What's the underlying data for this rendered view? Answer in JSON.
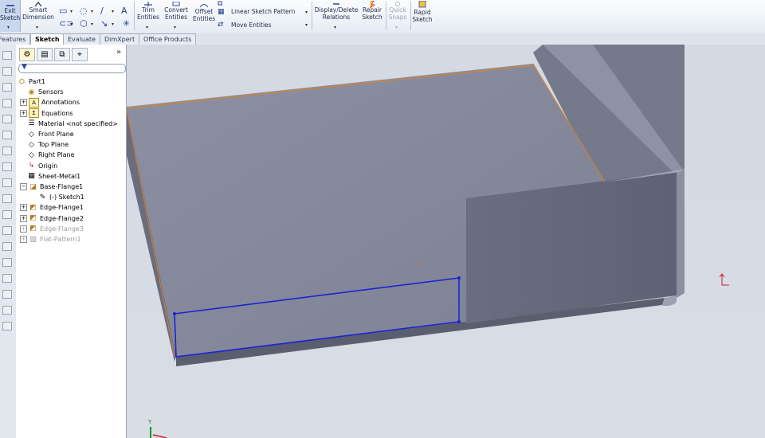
{
  "ribbon": {
    "exit_sketch": "Exit\nSketch",
    "smart_dimension": "Smart\nDimension",
    "trim_entities": "Trim\nEntities",
    "convert_entities": "Convert\nEntities",
    "offset_entities": "Offset\nEntities",
    "linear_sketch_pattern": "Linear Sketch Pattern",
    "move_entities": "Move Entities",
    "display_delete_relations": "Display/Delete\nRelations",
    "repair_sketch": "Repair\nSketch",
    "quick_snaps": "Quick\nSnaps",
    "rapid_sketch": "Rapid\nSketch"
  },
  "tabs": [
    "Features",
    "Sketch",
    "Evaluate",
    "DimXpert",
    "Office Products"
  ],
  "active_tab": "Sketch",
  "tree": {
    "nodes": [
      {
        "label": "Part1",
        "icon": "part-icon",
        "expander": ""
      },
      {
        "label": "Sensors",
        "icon": "sensors-icon",
        "expander": ""
      },
      {
        "label": "Annotations",
        "icon": "annotations-icon",
        "expander": "+"
      },
      {
        "label": "Equations",
        "icon": "equations-icon",
        "expander": "+"
      },
      {
        "label": "Material <not specified>",
        "icon": "material-icon",
        "expander": ""
      },
      {
        "label": "Front Plane",
        "icon": "plane-icon",
        "expander": ""
      },
      {
        "label": "Top Plane",
        "icon": "plane-icon",
        "expander": ""
      },
      {
        "label": "Right Plane",
        "icon": "plane-icon",
        "expander": ""
      },
      {
        "label": "Origin",
        "icon": "origin-icon",
        "expander": ""
      },
      {
        "label": "Sheet-Metal1",
        "icon": "sheet-metal-icon",
        "expander": ""
      },
      {
        "label": "Base-Flange1",
        "icon": "base-flange-icon",
        "expander": "-"
      },
      {
        "label": "(-) Sketch1",
        "icon": "sketch-icon",
        "expander": ""
      },
      {
        "label": "Edge-Flange1",
        "icon": "edge-flange-icon",
        "expander": "+"
      },
      {
        "label": "Edge-Flange2",
        "icon": "edge-flange-icon",
        "expander": "+"
      },
      {
        "label": "Edge-Flange3",
        "icon": "edge-flange-icon",
        "expander": "+"
      },
      {
        "label": "Flat-Pattern1",
        "icon": "flat-pattern-icon",
        "expander": "+"
      }
    ]
  },
  "viewport": {
    "triad_y_label": "Y",
    "sketch_color": "#1a23d6",
    "edge_highlight_color": "#d9822b"
  }
}
